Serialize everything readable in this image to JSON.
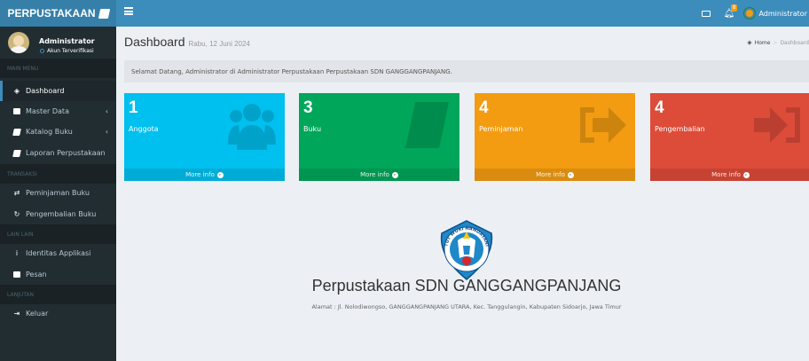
{
  "app": {
    "brand": "PERPUSTAKAAN",
    "colors": {
      "header": "#3c8dbc",
      "brand_bg": "#367fa9",
      "sidebar": "#222d32",
      "content_bg": "#ecf0f5"
    }
  },
  "topbar": {
    "icons": [
      "menu-icon",
      "mail-icon",
      "bell-icon"
    ],
    "notification_count": "8",
    "user_label": "Administrator"
  },
  "sidebar": {
    "user": {
      "name": "Administrator",
      "status": "Akun Terverifikasi"
    },
    "headers": {
      "main": "MAIN MENU",
      "transaksi": "TRANSAKSI",
      "lain": "LAIN LAIN",
      "lanjutan": "LANJUTAN"
    },
    "items": {
      "dashboard": "Dashboard",
      "master_data": "Master Data",
      "katalog_buku": "Katalog Buku",
      "laporan": "Laporan Perpustakaan",
      "peminjaman_buku": "Peminjaman Buku",
      "pengembalian_buku": "Pengembalian Buku",
      "identitas": "Identitas Applikasi",
      "pesan": "Pesan",
      "keluar": "Keluar"
    }
  },
  "main": {
    "title": "Dashboard",
    "subtitle": "Rabu, 12 Juni 2024",
    "breadcrumb": {
      "home": "Home",
      "current": "Dashboard"
    },
    "welcome": "Selamat Datang, Administrator di Administrator Perpustakaan Perpustakaan SDN GANGGANGPANJANG.",
    "boxes": [
      {
        "value": "1",
        "label": "Anggota",
        "footer": "More info",
        "color": "#00c0ef",
        "icon": "users-icon"
      },
      {
        "value": "3",
        "label": "Buku",
        "footer": "More info",
        "color": "#00a65a",
        "icon": "book-icon"
      },
      {
        "value": "4",
        "label": "Peminjaman",
        "footer": "More info",
        "color": "#f39c12",
        "icon": "sign-out-icon"
      },
      {
        "value": "4",
        "label": "Pengembalian",
        "footer": "More info",
        "color": "#dd4b39",
        "icon": "sign-in-icon"
      }
    ],
    "school_name": "Perpustakaan SDN GANGGANGPANJANG",
    "school_address": "Alamat : Jl. Nolodiwongso, GANGGANGPANJANG UTARA, Kec. Tanggulangin, Kabupaten Sidoarjo, Jawa Timur",
    "logo_text": "TUT WURI HANDAYANI"
  }
}
